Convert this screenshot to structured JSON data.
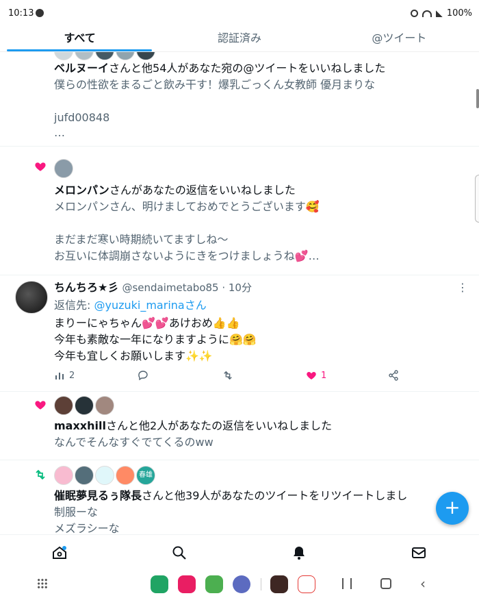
{
  "status_bar": {
    "time": "10:13",
    "battery": "100%"
  },
  "tabs": [
    {
      "label": "すべて"
    },
    {
      "label": "認証済み"
    },
    {
      "label": "@ツイート"
    }
  ],
  "notifications": {
    "n1": {
      "title_name": "ベルヌーイ",
      "title_rest": "さんと他54人があなた宛の@ツイートをいいねしました",
      "line1": "僕らの性欲をまるごと飲み干す！爆乳ごっくん女教師 優月まりな",
      "line2": "jufd00848",
      "line3": "…"
    },
    "n2": {
      "title_name": "メロンパン",
      "title_rest": "さんがあなたの返信をいいねしました",
      "line1": "メロンパンさん、明けましておめでとうございます🥰",
      "line2": "まだまだ寒い時期続いてますしね～",
      "line3": "お互いに体調崩さないようにきをつけましょうね💕…"
    },
    "tweet": {
      "name": "ちんちろ★彡",
      "handle": "@sendaimetabo85 · 10分",
      "reply_prefix": "返信先: ",
      "reply_to": "@yuzuki_marinaさん",
      "line1": "まりーにゃちゃん💕💕あけおめ👍👍",
      "line2": "今年も素敵な一年になりますように🤗🤗",
      "line3": "今年も宜しくお願いします✨✨",
      "views": "2",
      "likes": "1"
    },
    "n3": {
      "title_name": "maxxhill",
      "title_rest": "さんと他2人があなたの返信をいいねしました",
      "line1": "なんでそんなすぐでてくるのww"
    },
    "n4": {
      "title_name": "催眠夢見るぅ隊長",
      "title_rest": "さんと他39人があなたのツイートをリツイートしまし",
      "line1": "制服ーな",
      "line2": "メズラシーな",
      "avatar_badge": "春雄"
    }
  },
  "colors": {
    "accent": "#1d9bf0",
    "like": "#f91880",
    "retweet": "#00ba7c"
  }
}
